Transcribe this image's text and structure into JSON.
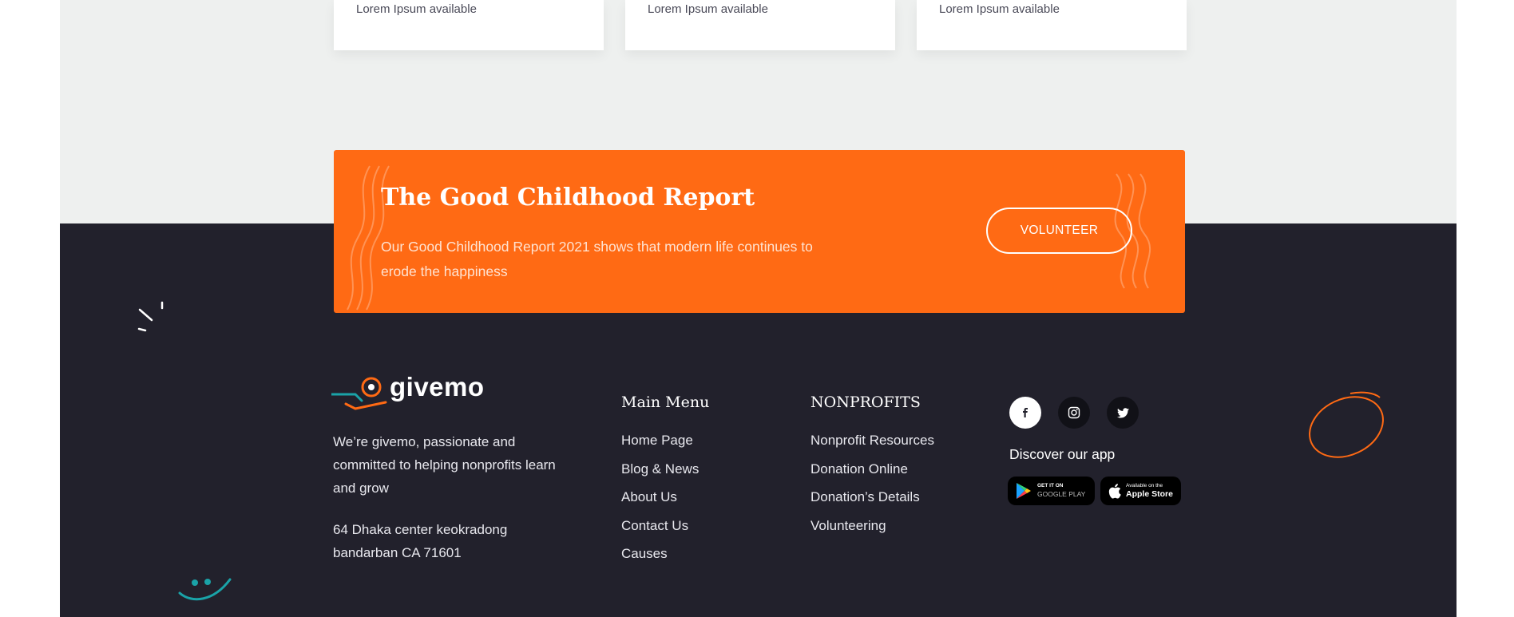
{
  "cards": [
    {
      "text": "Lorem Ipsum available"
    },
    {
      "text": "Lorem Ipsum available"
    },
    {
      "text": "Lorem Ipsum available"
    }
  ],
  "banner": {
    "title": "The Good Childhood Report",
    "description": "Our Good Childhood Report 2021 shows that modern life continues  to erode the happiness",
    "button_label": "VOLUNTEER"
  },
  "footer": {
    "brand": "givemo",
    "about": "We’re givemo, passionate and committed to helping nonprofits learn and grow",
    "address_line1": "64 Dhaka center keokradong",
    "address_line2": "bandarban CA 71601",
    "main_menu": {
      "title": "Main Menu",
      "items": [
        "Home Page",
        "Blog & News",
        "About Us",
        "Contact Us",
        "Causes"
      ]
    },
    "nonprofits": {
      "title": "NONPROFITS",
      "items": [
        "Nonprofit Resources",
        "Donation Online",
        "Donation’s Details",
        "Volunteering"
      ]
    },
    "social": [
      "facebook-icon",
      "instagram-icon",
      "twitter-icon"
    ],
    "discover_label": "Discover our app",
    "google_play": {
      "small": "GET IT ON",
      "big": "GOOGLE PLAY"
    },
    "apple_store": {
      "small": "Available on the",
      "big": "Apple Store"
    }
  },
  "colors": {
    "accent": "#ff6a14",
    "footer_bg": "#22212c",
    "top_band": "#eef0ef",
    "teal": "#1aa3a8"
  }
}
